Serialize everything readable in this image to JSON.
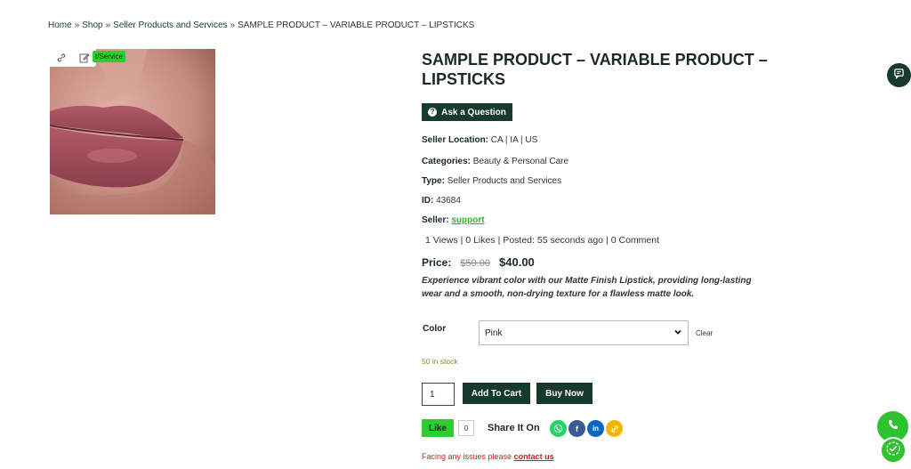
{
  "breadcrumb": {
    "items": [
      "Home",
      "Shop",
      "Seller Products and Services"
    ],
    "separator": "»",
    "current": "SAMPLE PRODUCT – VARIABLE PRODUCT – LIPSTICKS"
  },
  "image": {
    "badge": "t/Service",
    "toolbar_icons": [
      "link-icon",
      "edit-icon"
    ]
  },
  "product": {
    "title": "SAMPLE PRODUCT – VARIABLE PRODUCT – LIPSTICKS",
    "ask_label": "Ask a Question",
    "seller_location_label": "Seller Location:",
    "seller_location_value": "CA | IA | US",
    "categories_label": "Categories:",
    "categories_value": "Beauty & Personal Care",
    "type_label": "Type:",
    "type_value": "Seller Products and Services",
    "id_label": "ID:",
    "id_value": "43684",
    "seller_label": "Seller:",
    "seller_value": "support",
    "stats": {
      "views": "1 Views",
      "likes": "0 Likes",
      "posted": "Posted: 55 seconds ago",
      "comments": "0 Comment"
    },
    "price_label": "Price:",
    "price_old": "$50.00",
    "price_new": "$40.00",
    "description": "Experience vibrant color with our Matte Finish Lipstick, providing long-lasting wear and a smooth, non-drying texture for a flawless matte look."
  },
  "variation": {
    "label": "Color",
    "selected": "Pink",
    "clear_label": "Clear"
  },
  "stock_text": "50 in stock",
  "cart": {
    "quantity": "1",
    "add_to_cart_label": "Add To Cart",
    "buy_now_label": "Buy Now"
  },
  "social": {
    "like_label": "Like",
    "like_count": "0",
    "share_label": "Share It On",
    "share_icons": [
      {
        "name": "whatsapp-icon",
        "color": "#25d366",
        "glyph": "✆"
      },
      {
        "name": "facebook-icon",
        "color": "#3b5998",
        "glyph": "f"
      },
      {
        "name": "linkedin-icon",
        "color": "#0a66c2",
        "glyph": "in"
      },
      {
        "name": "copy-link-icon",
        "color": "#f4b400",
        "glyph": "🔗"
      }
    ]
  },
  "support": {
    "text": "Facing any issues please",
    "link": "contact us"
  },
  "colors": {
    "accent_dark": "#173b2a",
    "accent_green": "#2ecc2e",
    "error_red": "#d02020"
  }
}
